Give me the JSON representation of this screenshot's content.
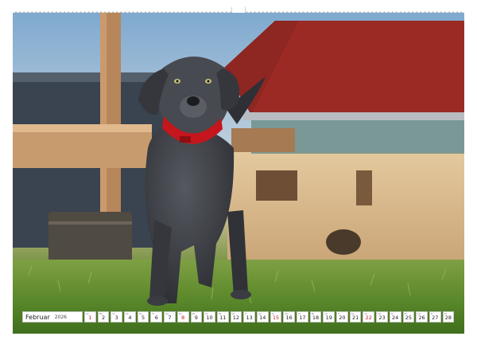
{
  "calendar": {
    "month": "Februar",
    "year": "2026",
    "days": [
      {
        "n": "1",
        "w": "So",
        "sun": true
      },
      {
        "n": "2",
        "w": "Mo"
      },
      {
        "n": "3",
        "w": "Di"
      },
      {
        "n": "4",
        "w": "Mi"
      },
      {
        "n": "5",
        "w": "Do"
      },
      {
        "n": "6",
        "w": "Fr"
      },
      {
        "n": "7",
        "w": "Sa"
      },
      {
        "n": "8",
        "w": "So",
        "sun": true
      },
      {
        "n": "9",
        "w": "Mo"
      },
      {
        "n": "10",
        "w": "Di"
      },
      {
        "n": "11",
        "w": "Mi"
      },
      {
        "n": "12",
        "w": "Do"
      },
      {
        "n": "13",
        "w": "Fr"
      },
      {
        "n": "14",
        "w": "Sa"
      },
      {
        "n": "15",
        "w": "So",
        "sun": true
      },
      {
        "n": "16",
        "w": "Mo"
      },
      {
        "n": "17",
        "w": "Di"
      },
      {
        "n": "18",
        "w": "Mi"
      },
      {
        "n": "19",
        "w": "Do"
      },
      {
        "n": "20",
        "w": "Fr"
      },
      {
        "n": "21",
        "w": "Sa"
      },
      {
        "n": "22",
        "w": "So",
        "sun": true
      },
      {
        "n": "23",
        "w": "Mo"
      },
      {
        "n": "24",
        "w": "Di"
      },
      {
        "n": "25",
        "w": "Mi"
      },
      {
        "n": "26",
        "w": "Do"
      },
      {
        "n": "27",
        "w": "Fr"
      },
      {
        "n": "28",
        "w": "Sa"
      }
    ]
  },
  "colors": {
    "sunday": "#c0192c",
    "roof": "#9c2a24",
    "collar": "#c4161c",
    "dog": "#3c3e45",
    "grass": "#5d8a2c"
  }
}
